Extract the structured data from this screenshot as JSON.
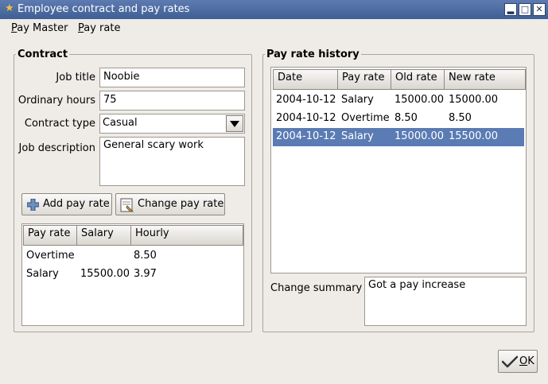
{
  "window": {
    "title": "Employee contract and pay rates"
  },
  "menu": [
    {
      "mnemonic": "P",
      "rest": "ay Master"
    },
    {
      "mnemonic": "P",
      "rest": "ay rate"
    }
  ],
  "contract": {
    "legend": "Contract",
    "job_title_label": "Job title",
    "job_title_value": "Noobie",
    "hours_label": "Ordinary hours",
    "hours_value": "75",
    "type_label": "Contract type",
    "type_value": "Casual",
    "desc_label": "Job description",
    "desc_value": "General scary work",
    "add_button": "Add pay rate",
    "change_button": "Change pay rate",
    "columns": [
      "Pay rate",
      "Salary",
      "Hourly"
    ],
    "rows": [
      {
        "rate": "Overtime",
        "salary": "",
        "hourly": "8.50"
      },
      {
        "rate": "Salary",
        "salary": "15500.00",
        "hourly": "3.97"
      }
    ]
  },
  "history": {
    "legend": "Pay rate history",
    "columns": [
      "Date",
      "Pay rate",
      "Old rate",
      "New rate"
    ],
    "rows": [
      {
        "date": "2004-10-12",
        "rate": "Salary",
        "old": "15000.00",
        "new": "15000.00"
      },
      {
        "date": "2004-10-12",
        "rate": "Overtime",
        "old": "8.50",
        "new": "8.50"
      },
      {
        "date": "2004-10-12",
        "rate": "Salary",
        "old": "15000.00",
        "new": "15500.00"
      }
    ],
    "selected_row": 2,
    "summary_label": "Change summary",
    "summary_value": "Got a pay increase"
  },
  "ok_button": {
    "mnemonic": "O",
    "rest": "K"
  }
}
